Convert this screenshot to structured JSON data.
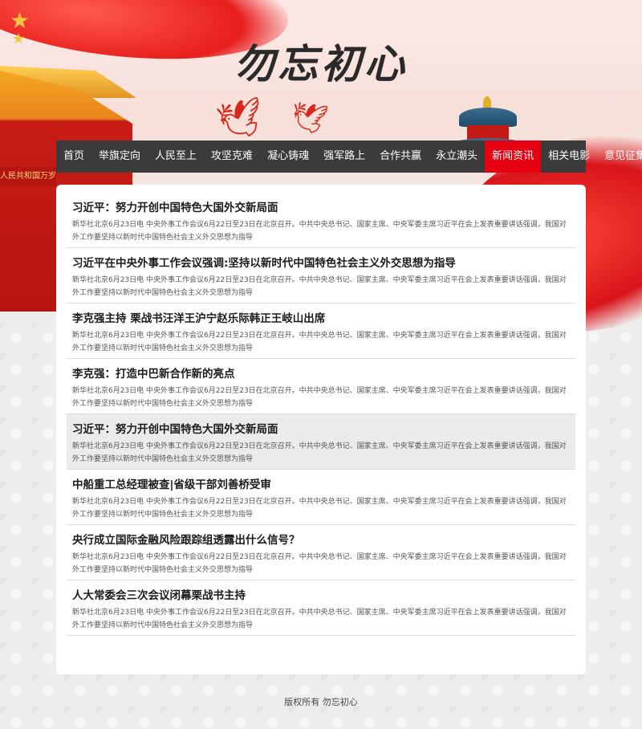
{
  "site": {
    "title": "勿忘初心"
  },
  "banner": {
    "gate_sign": "人民共和国万岁"
  },
  "nav": {
    "items": [
      {
        "label": "首页"
      },
      {
        "label": "举旗定向"
      },
      {
        "label": "人民至上"
      },
      {
        "label": "攻坚克难"
      },
      {
        "label": "凝心铸魂"
      },
      {
        "label": "强军路上"
      },
      {
        "label": "合作共赢"
      },
      {
        "label": "永立潮头"
      },
      {
        "label": "新闻资讯",
        "active": true
      },
      {
        "label": "相关电影"
      },
      {
        "label": "意见征集"
      }
    ],
    "active_color": "#e60012",
    "bar_color": "#3b3b3b"
  },
  "articles": [
    {
      "title": "习近平：努力开创中国特色大国外交新局面",
      "summary": "新华社北京6月23日电 中央外事工作会议6月22日至23日在北京召开。中共中央总书记、国家主席、中央军委主席习近平在会上发表重要讲话强调，我国对外工作要坚持以新时代中国特色社会主义外交思想为指导"
    },
    {
      "title": "习近平在中央外事工作会议强调:坚持以新时代中国特色社会主义外交思想为指导",
      "summary": "新华社北京6月23日电 中央外事工作会议6月22日至23日在北京召开。中共中央总书记、国家主席、中央军委主席习近平在会上发表重要讲话强调，我国对外工作要坚持以新时代中国特色社会主义外交思想为指导"
    },
    {
      "title": "李克强主持 栗战书汪洋王沪宁赵乐际韩正王岐山出席",
      "summary": "新华社北京6月23日电 中央外事工作会议6月22日至23日在北京召开。中共中央总书记、国家主席、中央军委主席习近平在会上发表重要讲话强调，我国对外工作要坚持以新时代中国特色社会主义外交思想为指导"
    },
    {
      "title": "李克强：打造中巴新合作新的亮点",
      "summary": "新华社北京6月23日电 中央外事工作会议6月22日至23日在北京召开。中共中央总书记、国家主席、中央军委主席习近平在会上发表重要讲话强调，我国对外工作要坚持以新时代中国特色社会主义外交思想为指导"
    },
    {
      "title": "习近平：努力开创中国特色大国外交新局面",
      "summary": "新华社北京6月23日电 中央外事工作会议6月22日至23日在北京召开。中共中央总书记、国家主席、中央军委主席习近平在会上发表重要讲话强调，我国对外工作要坚持以新时代中国特色社会主义外交思想为指导",
      "highlighted": true
    },
    {
      "title": "中船重工总经理被查|省级干部刘善桥受审",
      "summary": "新华社北京6月23日电 中央外事工作会议6月22日至23日在北京召开。中共中央总书记、国家主席、中央军委主席习近平在会上发表重要讲话强调，我国对外工作要坚持以新时代中国特色社会主义外交思想为指导"
    },
    {
      "title": "央行成立国际金融风险跟踪组透露出什么信号？",
      "summary": "新华社北京6月23日电 中央外事工作会议6月22日至23日在北京召开。中共中央总书记、国家主席、中央军委主席习近平在会上发表重要讲话强调，我国对外工作要坚持以新时代中国特色社会主义外交思想为指导"
    },
    {
      "title": "人大常委会三次会议闭幕栗战书主持",
      "summary": "新华社北京6月23日电 中央外事工作会议6月22日至23日在北京召开。中共中央总书记、国家主席、中央军委主席习近平在会上发表重要讲话强调，我国对外工作要坚持以新时代中国特色社会主义外交思想为指导"
    }
  ],
  "footer": {
    "text": "版权所有 勿忘初心"
  }
}
